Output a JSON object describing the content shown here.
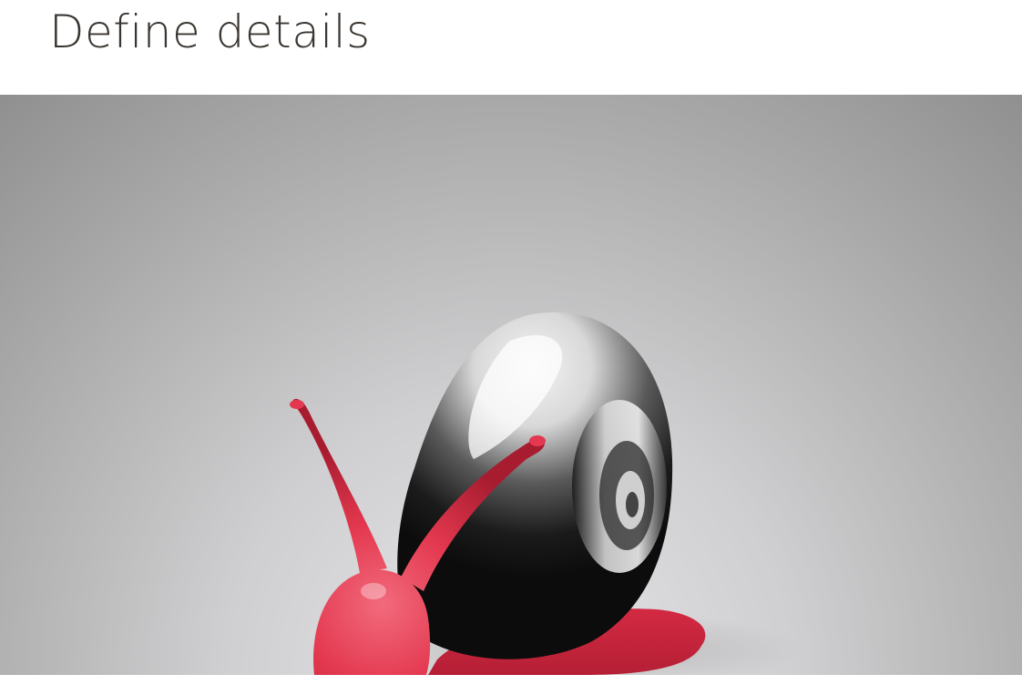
{
  "slide": {
    "title": "Define details"
  },
  "render": {
    "subject_icon": "snail-render",
    "colors": {
      "backdrop_top": "#8e8e8e",
      "backdrop_bottom": "#e4e4e6",
      "body": "#e3384f",
      "body_dark": "#a81c30",
      "shell_light": "#f2f2f2",
      "shell_dark": "#111111"
    }
  }
}
